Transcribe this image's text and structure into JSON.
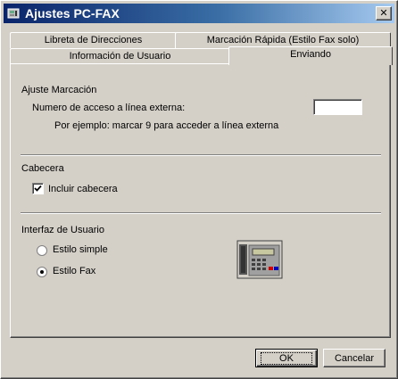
{
  "window": {
    "title": "Ajustes PC-FAX",
    "close_glyph": "✕",
    "icon": "pcfax-app-icon"
  },
  "tabs": {
    "row_back": [
      "Libreta de Direcciones",
      "Marcación Rápida (Estilo Fax solo)"
    ],
    "row_front": [
      "Información de Usuario",
      "Enviando"
    ],
    "active": "Enviando"
  },
  "dial": {
    "group_label": "Ajuste Marcación",
    "access_label": "Numero de acceso a línea externa:",
    "access_value": "",
    "example": "Por ejemplo: marcar 9 para acceder a línea externa"
  },
  "header": {
    "group_label": "Cabecera",
    "include_label": "Incluir cabecera",
    "include_checked": true
  },
  "ui": {
    "group_label": "Interfaz de Usuario",
    "options": [
      "Estilo simple",
      "Estilo Fax"
    ],
    "selected": "Estilo Fax",
    "preview_icon": "fax-machine-icon"
  },
  "buttons": {
    "ok": "OK",
    "cancel": "Cancelar"
  }
}
